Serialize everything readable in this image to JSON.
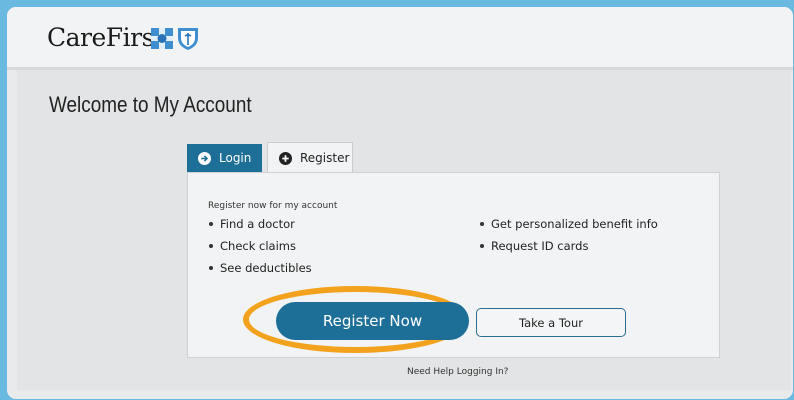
{
  "header": {
    "logo_text": "CareFirst",
    "logo_icons": [
      "blue-cross-icon",
      "blue-shield-icon"
    ]
  },
  "main": {
    "title": "Welcome to My Account",
    "tabs": [
      {
        "label": "Login",
        "icon": "arrow-right-circle-icon",
        "active": false
      },
      {
        "label": "Register",
        "icon": "plus-circle-icon",
        "active": true
      }
    ],
    "register": {
      "intro": "Register now for my account",
      "benefits_left": [
        "Find a doctor",
        "Check claims",
        "See deductibles"
      ],
      "benefits_right": [
        "Get personalized benefit info",
        "Request ID cards"
      ],
      "register_button": "Register Now",
      "tour_button": "Take a Tour"
    },
    "help_link": "Need Help Logging In?"
  },
  "colors": {
    "brand_blue": "#1d6f98",
    "highlight_orange": "#f3a21d",
    "background_blue": "#6ab9e0"
  }
}
